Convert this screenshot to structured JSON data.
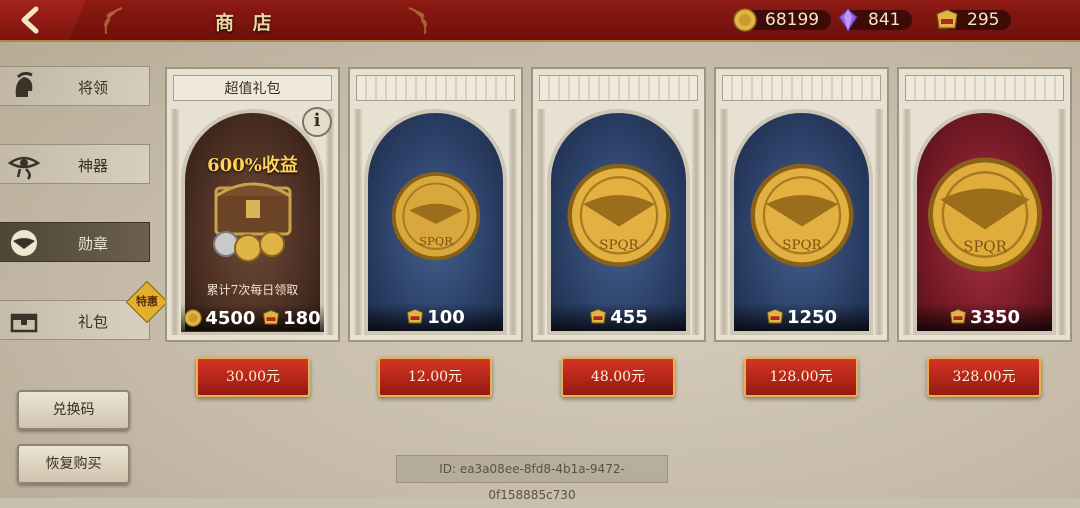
{
  "header": {
    "title": "商 店"
  },
  "currencies": [
    {
      "icon": "gold-coin-icon",
      "value": "68199"
    },
    {
      "icon": "purple-gem-icon",
      "value": "841"
    },
    {
      "icon": "spqr-token-icon",
      "value": "295"
    }
  ],
  "sidebar": {
    "tabs": [
      {
        "label": "将领",
        "icon": "helmet-icon"
      },
      {
        "label": "神器",
        "icon": "eye-of-horus-icon"
      },
      {
        "label": "勋章",
        "icon": "eagle-medal-icon"
      },
      {
        "label": "礼包",
        "icon": "chest-icon"
      }
    ],
    "badge": "特惠",
    "redeem_label": "兑换码",
    "restore_label": "恢复购买"
  },
  "cards": [
    {
      "header": "超值礼包",
      "promo": "600%收益",
      "cumulative": "累计7次每日领取",
      "reward_gold": "4500",
      "reward_token": "180",
      "price": "30.00元"
    },
    {
      "reward": "100",
      "price": "12.00元"
    },
    {
      "reward": "455",
      "price": "48.00元"
    },
    {
      "reward": "1250",
      "price": "128.00元"
    },
    {
      "reward": "3350",
      "price": "328.00元"
    }
  ],
  "footer": {
    "id_text": "ID: ea3a08ee-8fd8-4b1a-9472-0f158885c730"
  },
  "colors": {
    "topbar": "#8e1a14",
    "gold": "#e3b02d",
    "buy": "#c42b1d"
  }
}
